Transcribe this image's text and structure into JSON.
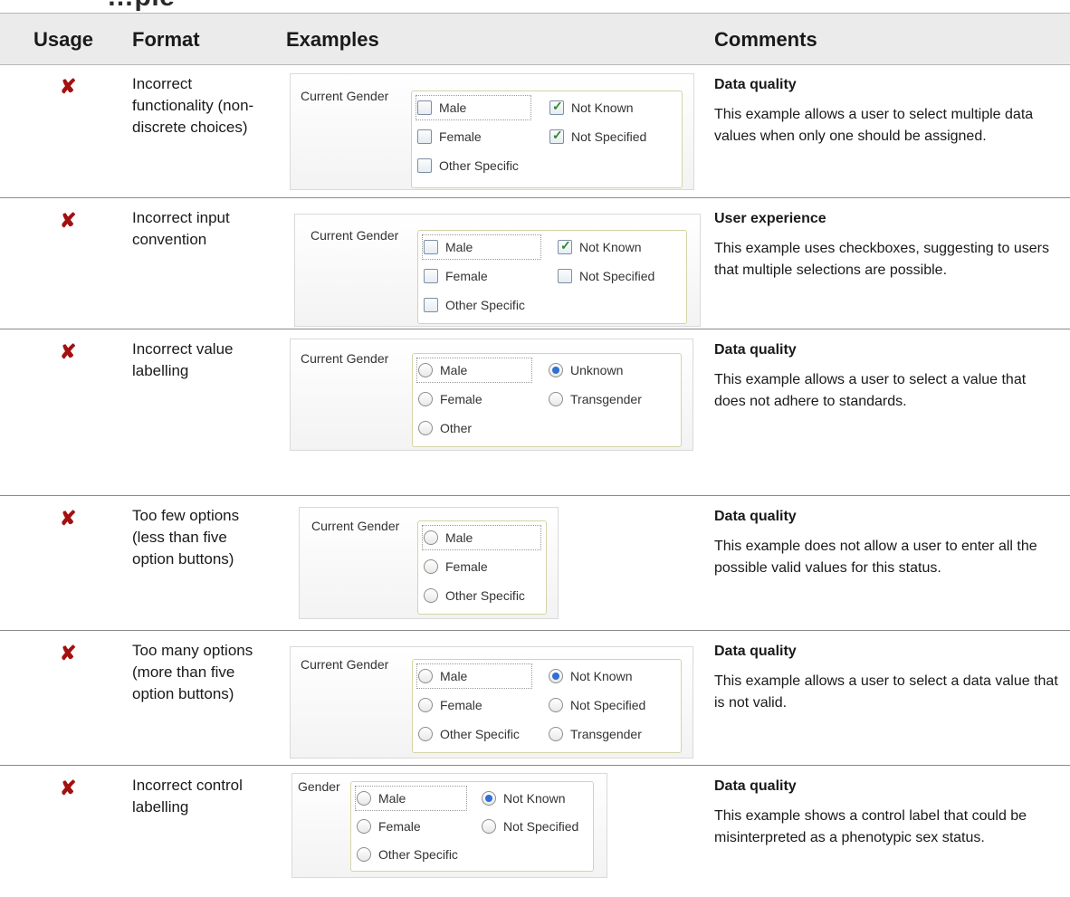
{
  "header": {
    "usage": "Usage",
    "format": "Format",
    "examples": "Examples",
    "comments": "Comments"
  },
  "colors": {
    "incorrect_mark": "#a31010",
    "header_bg": "#ebebeb",
    "radio_selected": "#2f6fd6",
    "check_mark": "#2b8a2b"
  },
  "usage_icon": "cross-mark-icon",
  "usage_glyph": "✘",
  "rows": [
    {
      "format": "Incorrect functionality (non-discrete choices)",
      "example": {
        "legend": "Current Gender",
        "control": "checkbox",
        "options": [
          {
            "label": "Male",
            "checked": false
          },
          {
            "label": "Not Known",
            "checked": true
          },
          {
            "label": "Female",
            "checked": false
          },
          {
            "label": "Not Specified",
            "checked": true
          },
          {
            "label": "Other Specific",
            "checked": false
          }
        ]
      },
      "comment_title": "Data quality",
      "comment_text": "This example allows a user to select multiple data values when only one should be assigned."
    },
    {
      "format": "Incorrect input convention",
      "example": {
        "legend": "Current Gender",
        "control": "checkbox",
        "options": [
          {
            "label": "Male",
            "checked": false
          },
          {
            "label": "Not Known",
            "checked": true
          },
          {
            "label": "Female",
            "checked": false
          },
          {
            "label": "Not Specified",
            "checked": false
          },
          {
            "label": "Other Specific",
            "checked": false
          }
        ]
      },
      "comment_title": "User experience",
      "comment_text": "This example uses checkboxes, suggesting to users that multiple selections are possible."
    },
    {
      "format": "Incorrect value labelling",
      "example": {
        "legend": "Current Gender",
        "control": "radio",
        "options": [
          {
            "label": "Male",
            "checked": false
          },
          {
            "label": "Unknown",
            "checked": true
          },
          {
            "label": "Female",
            "checked": false
          },
          {
            "label": "Transgender",
            "checked": false
          },
          {
            "label": "Other",
            "checked": false
          }
        ]
      },
      "comment_title": "Data quality",
      "comment_text": "This example allows a user to select a value that does not adhere to standards."
    },
    {
      "format": "Too few options (less than five option buttons)",
      "example": {
        "legend": "Current Gender",
        "control": "radio",
        "options": [
          {
            "label": "Male",
            "checked": false
          },
          {
            "label": "Female",
            "checked": false
          },
          {
            "label": "Other Specific",
            "checked": false
          }
        ]
      },
      "comment_title": "Data quality",
      "comment_text": "This example does not allow a user to enter all the possible valid values for this status."
    },
    {
      "format": "Too many options (more than five option buttons)",
      "example": {
        "legend": "Current Gender",
        "control": "radio",
        "options": [
          {
            "label": "Male",
            "checked": false
          },
          {
            "label": "Not Known",
            "checked": true
          },
          {
            "label": "Female",
            "checked": false
          },
          {
            "label": "Not Specified",
            "checked": false
          },
          {
            "label": "Other Specific",
            "checked": false
          },
          {
            "label": "Transgender",
            "checked": false
          }
        ]
      },
      "comment_title": "Data quality",
      "comment_text": "This example allows a user to select a data value that is not valid."
    },
    {
      "format": "Incorrect control labelling",
      "example": {
        "legend": "Gender",
        "control": "radio",
        "options": [
          {
            "label": "Male",
            "checked": false
          },
          {
            "label": "Not Known",
            "checked": true
          },
          {
            "label": "Female",
            "checked": false
          },
          {
            "label": "Not Specified",
            "checked": false
          },
          {
            "label": "Other Specific",
            "checked": false
          }
        ]
      },
      "comment_title": "Data quality",
      "comment_text": "This example shows a control label that could be misinterpreted as a phenotypic sex status."
    }
  ]
}
